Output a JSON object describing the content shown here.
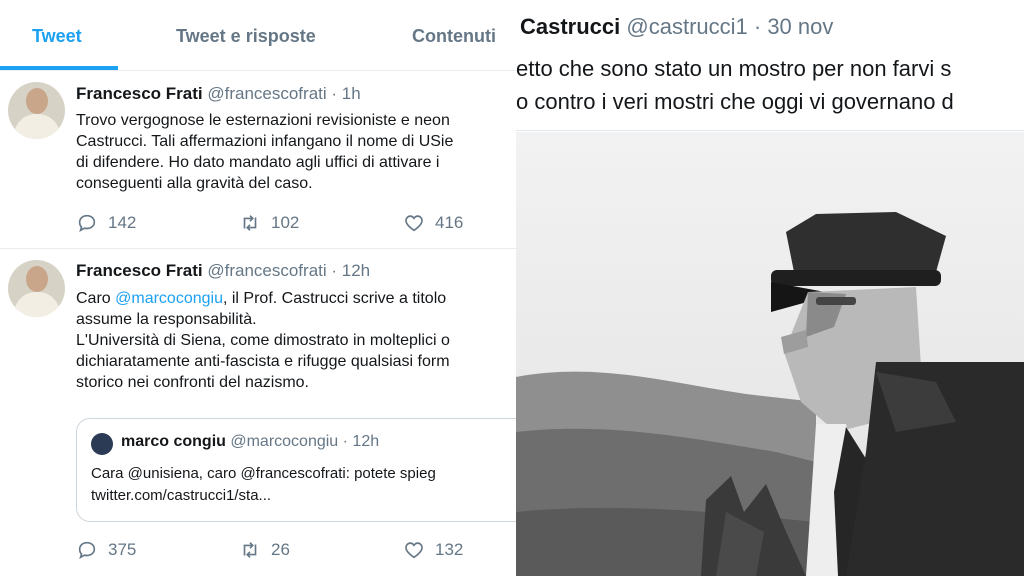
{
  "tabs": [
    "Tweet",
    "Tweet e risposte",
    "Contenuti"
  ],
  "tweets": [
    {
      "name": "Francesco Frati",
      "handle": "@francescofrati · 1h",
      "lines": [
        "Trovo vergognose le esternazioni revisioniste e neon",
        "Castrucci. Tali affermazioni infangano il nome di USie",
        "di difendere. Ho dato mandato agli uffici di attivare i",
        "conseguenti alla gravità del caso."
      ],
      "replies": "142",
      "retweets": "102",
      "likes": "416"
    },
    {
      "name": "Francesco Frati",
      "handle": "@francescofrati · 12h",
      "line1_pre": "Caro ",
      "line1_mention": "@marcocongiu",
      "line1_post": ", il Prof. Castrucci scrive a titolo",
      "lines": [
        "assume la responsabilità.",
        "L'Università di Siena, come dimostrato in molteplici o",
        "dichiaratamente anti-fascista e rifugge qualsiasi form",
        "storico nei confronti del nazismo."
      ],
      "quote": {
        "name": "marco congiu",
        "handle": "@marcocongiu · 12h",
        "lines": [
          "Cara @unisiena, caro @francescofrati: potete spieg",
          "twitter.com/castrucci1/sta..."
        ]
      },
      "replies": "375",
      "retweets": "26",
      "likes": "132"
    }
  ],
  "right_tweet": {
    "name": "Castrucci",
    "handle": "@castrucci1 · 30 nov",
    "lines": [
      "etto che sono stato un mostro per non farvi s",
      "o contro i veri mostri che oggi vi governano d"
    ]
  },
  "colors": {
    "accent": "#1da1f2",
    "secondary_text": "#657786"
  }
}
